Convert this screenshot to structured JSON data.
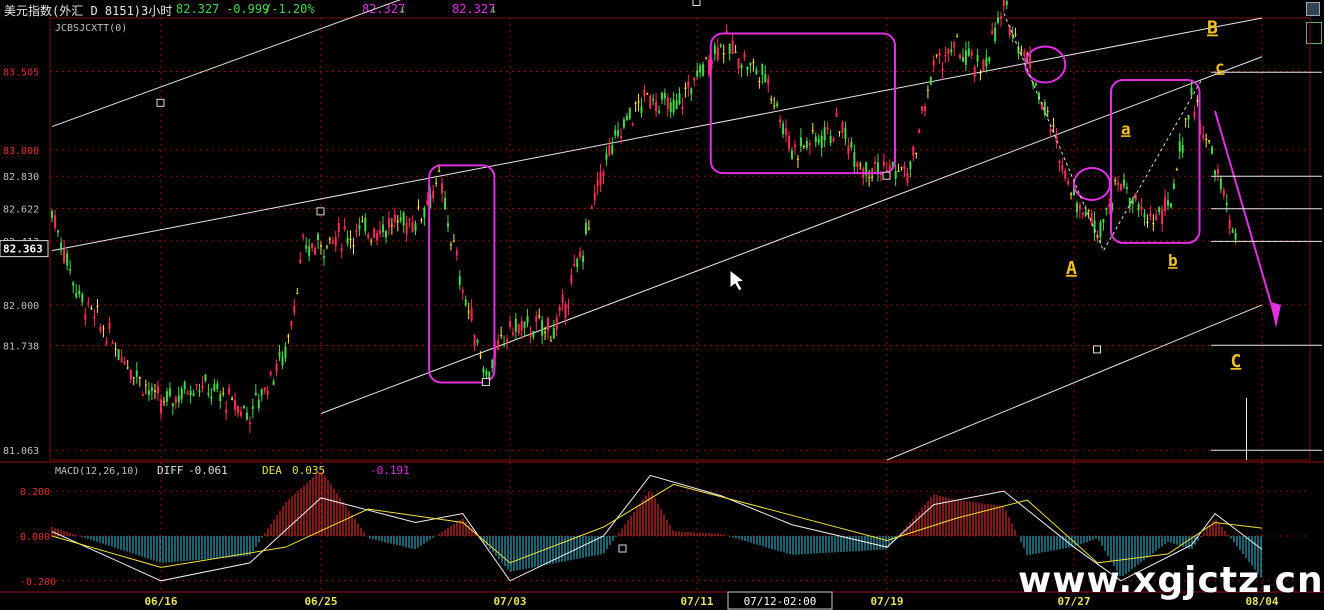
{
  "header": {
    "title": "美元指数(外汇_D 8151)3小时",
    "price": "82.327",
    "change": "-0.999",
    "pct": "/-1.20%",
    "quote1": "82.327",
    "quote2": "82.327",
    "arrow_down": "↓"
  },
  "colors": {
    "up": "#ff2a5a",
    "down": "#44d84a",
    "flat": "#ffe040",
    "box": "#e030e0",
    "label": "#f0c020"
  },
  "main": {
    "indicator_name": "JCBSJCXTT(0)",
    "current_value": "82.363",
    "y_ticks": [
      "83.505",
      "83.000",
      "82.830",
      "82.622",
      "82.413",
      "82.000",
      "81.738",
      "81.063"
    ]
  },
  "wave_labels": [
    "A",
    "B",
    "C",
    "a",
    "b",
    "c"
  ],
  "macd": {
    "title": "MACD(12,26,10)",
    "diff_label": "DIFF",
    "diff_value": "-0.061",
    "dea_label": "DEA",
    "dea_value": "0.035",
    "macd_value": "-0.191",
    "y_ticks": [
      "0.200",
      "0.000",
      "-0.200"
    ]
  },
  "x_axis": {
    "dates": [
      "06/16",
      "06/25",
      "07/03",
      "07/11",
      "07/19",
      "07/27",
      "08/04"
    ],
    "cursor": "07/12-02:00"
  },
  "watermark": "www.xgjctz.cn",
  "chart_data": {
    "type": "candlestick",
    "ylim": [
      81.0,
      83.85
    ],
    "macd_ylim": [
      -0.25,
      0.33
    ],
    "x": [
      "06/16",
      "06/25",
      "07/03",
      "07/11",
      "07/19",
      "07/27",
      "08/04"
    ],
    "price_path": [
      {
        "x": "06/12",
        "y": 82.6
      },
      {
        "x": "06/13",
        "y": 82.05
      },
      {
        "x": "06/16",
        "y": 81.35
      },
      {
        "x": "06/18",
        "y": 81.5
      },
      {
        "x": "06/21",
        "y": 81.3
      },
      {
        "x": "06/23",
        "y": 81.7
      },
      {
        "x": "06/24",
        "y": 82.35
      },
      {
        "x": "06/26",
        "y": 82.45
      },
      {
        "x": "06/29",
        "y": 82.55
      },
      {
        "x": "06/30",
        "y": 82.8
      },
      {
        "x": "07/01",
        "y": 82.1
      },
      {
        "x": "07/02",
        "y": 81.55
      },
      {
        "x": "07/03",
        "y": 81.85
      },
      {
        "x": "07/05",
        "y": 81.85
      },
      {
        "x": "07/06",
        "y": 82.3
      },
      {
        "x": "07/07",
        "y": 82.9
      },
      {
        "x": "07/08",
        "y": 83.2
      },
      {
        "x": "07/09",
        "y": 83.35
      },
      {
        "x": "07/10",
        "y": 83.25
      },
      {
        "x": "07/12",
        "y": 83.7
      },
      {
        "x": "07/14",
        "y": 83.45
      },
      {
        "x": "07/15",
        "y": 83.0
      },
      {
        "x": "07/17",
        "y": 83.15
      },
      {
        "x": "07/18",
        "y": 82.9
      },
      {
        "x": "07/20",
        "y": 82.85
      },
      {
        "x": "07/21",
        "y": 83.55
      },
      {
        "x": "07/22",
        "y": 83.65
      },
      {
        "x": "07/23",
        "y": 83.5
      },
      {
        "x": "07/24",
        "y": 83.9
      },
      {
        "x": "07/25",
        "y": 83.6
      },
      {
        "x": "07/27",
        "y": 82.7
      },
      {
        "x": "07/28",
        "y": 82.5
      },
      {
        "x": "07/29",
        "y": 82.8
      },
      {
        "x": "07/30",
        "y": 82.55
      },
      {
        "x": "07/31",
        "y": 82.6
      },
      {
        "x": "08/01",
        "y": 83.35
      },
      {
        "x": "08/02",
        "y": 82.9
      },
      {
        "x": "08/03",
        "y": 82.35
      }
    ],
    "macd_diff": [
      {
        "x": "06/12",
        "y": 0.02
      },
      {
        "x": "06/16",
        "y": -0.2
      },
      {
        "x": "06/21",
        "y": -0.12
      },
      {
        "x": "06/25",
        "y": 0.17
      },
      {
        "x": "06/29",
        "y": 0.06
      },
      {
        "x": "07/01",
        "y": 0.1
      },
      {
        "x": "07/03",
        "y": -0.2
      },
      {
        "x": "07/07",
        "y": 0.0
      },
      {
        "x": "07/09",
        "y": 0.27
      },
      {
        "x": "07/12",
        "y": 0.18
      },
      {
        "x": "07/15",
        "y": 0.05
      },
      {
        "x": "07/19",
        "y": -0.05
      },
      {
        "x": "07/21",
        "y": 0.14
      },
      {
        "x": "07/24",
        "y": 0.2
      },
      {
        "x": "07/27",
        "y": -0.05
      },
      {
        "x": "07/29",
        "y": -0.2
      },
      {
        "x": "08/01",
        "y": -0.04
      },
      {
        "x": "08/02",
        "y": 0.1
      },
      {
        "x": "08/04",
        "y": -0.06
      }
    ],
    "macd_dea": [
      {
        "x": "06/12",
        "y": 0.0
      },
      {
        "x": "06/16",
        "y": -0.14
      },
      {
        "x": "06/23",
        "y": -0.05
      },
      {
        "x": "06/27",
        "y": 0.12
      },
      {
        "x": "07/01",
        "y": 0.06
      },
      {
        "x": "07/03",
        "y": -0.12
      },
      {
        "x": "07/07",
        "y": 0.04
      },
      {
        "x": "07/10",
        "y": 0.23
      },
      {
        "x": "07/14",
        "y": 0.12
      },
      {
        "x": "07/19",
        "y": -0.02
      },
      {
        "x": "07/22",
        "y": 0.08
      },
      {
        "x": "07/25",
        "y": 0.16
      },
      {
        "x": "07/28",
        "y": -0.12
      },
      {
        "x": "07/31",
        "y": -0.08
      },
      {
        "x": "08/02",
        "y": 0.06
      },
      {
        "x": "08/04",
        "y": 0.035
      }
    ],
    "channel_lines": [
      {
        "from": {
          "x": "06/12",
          "y": 83.15
        },
        "to": {
          "x": "07/08",
          "y": 84.5
        }
      },
      {
        "from": {
          "x": "06/12",
          "y": 82.35
        },
        "to": {
          "x": "08/04",
          "y": 83.85
        }
      },
      {
        "from": {
          "x": "06/25",
          "y": 81.3
        },
        "to": {
          "x": "08/04",
          "y": 83.6
        }
      },
      {
        "from": {
          "x": "07/19",
          "y": 81.0
        },
        "to": {
          "x": "08/04",
          "y": 82.0
        }
      }
    ],
    "wave_points": [
      {
        "label": "A",
        "x": "07/27",
        "y": 82.2
      },
      {
        "label": "B",
        "x": "08/02",
        "y": 83.75
      },
      {
        "label": "C",
        "x": "08/03",
        "y": 81.6
      },
      {
        "label": "a",
        "x": "07/29",
        "y": 83.1
      },
      {
        "label": "b",
        "x": "07/31",
        "y": 82.25
      },
      {
        "label": "c",
        "x": "08/02",
        "y": 83.5
      }
    ],
    "right_guides": [
      83.5,
      82.83,
      82.62,
      82.41,
      81.74,
      81.063
    ]
  }
}
